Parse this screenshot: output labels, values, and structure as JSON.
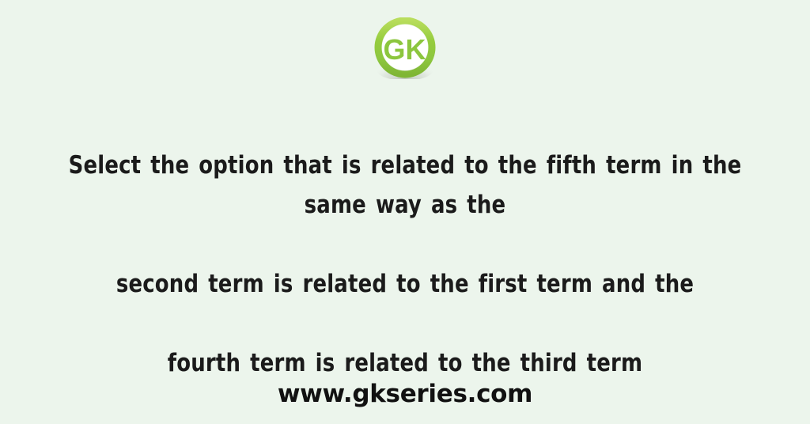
{
  "page": {
    "background_color": "#ecf5ec",
    "text_color": "#1b1b1b"
  },
  "logo": {
    "name": "gk-logo",
    "text": "GK",
    "letter_g": "G",
    "letter_k": "K",
    "ring_color": "#8dc63f",
    "ring_highlight_color": "#b5d957",
    "letter_g_color": "#7ab82c",
    "letter_k_color": "#95cc3e",
    "inner_color": "#ffffff",
    "shadow_color": "#b9bdb5"
  },
  "question": {
    "line1": "Select the option that is related to the fifth term in the same way as the",
    "line2": "second term is related to the first term and the",
    "line3": "fourth term is related to the third term",
    "full_text": "Select the option that is related to the fifth term in the same way as the second term is related to the first term and the fourth term is related to the third term"
  },
  "footer": {
    "website": "www.gkseries.com"
  }
}
